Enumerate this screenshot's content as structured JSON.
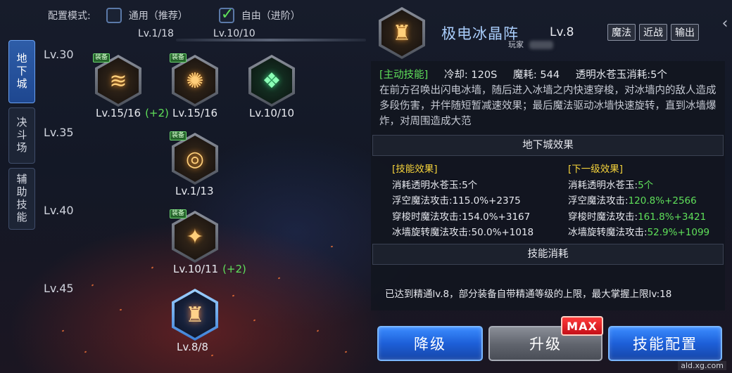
{
  "mode": {
    "label": "配置模式:",
    "options": [
      {
        "label": "通用（推荐）",
        "checked": false
      },
      {
        "label": "自由（进阶）",
        "checked": true
      }
    ]
  },
  "sp": {
    "left": "Lv.1/18",
    "right": "Lv.10/10"
  },
  "side_tabs": [
    {
      "label": "地下城",
      "active": true
    },
    {
      "label": "决斗场",
      "active": false
    },
    {
      "label": "辅助技能",
      "active": false
    }
  ],
  "level_rows": [
    "Lv.30",
    "Lv.35",
    "Lv.40",
    "Lv.45"
  ],
  "skills": [
    {
      "icon": "fire-slash-icon",
      "equip": "装备",
      "level": "Lv.15/16",
      "bonus": "(+2)"
    },
    {
      "icon": "fire-burst-icon",
      "equip": "装备",
      "level": "Lv.15/16",
      "bonus": ""
    },
    {
      "icon": "green-rune-icon",
      "equip": "",
      "level": "Lv.10/10",
      "bonus": ""
    },
    {
      "icon": "fire-orb-icon",
      "equip": "装备",
      "level": "Lv.1/13",
      "bonus": ""
    },
    {
      "icon": "rock-flame-icon",
      "equip": "装备",
      "level": "Lv.10/11",
      "bonus": "(+2)"
    },
    {
      "icon": "crystal-array-icon",
      "equip": "",
      "level": "Lv.8/8",
      "bonus": ""
    }
  ],
  "detail": {
    "title": "极电冰晶阵",
    "level": "Lv.8",
    "owner": "玩家",
    "tags": [
      "魔法",
      "近战",
      "输出"
    ],
    "active_tag": "[主动技能]",
    "cooldown": "冷却: 120S",
    "mana": "魔耗: 544",
    "cost": "透明水苍玉消耗:5个",
    "description": "在前方召唤出闪电冰墙，随后进入冰墙之内快速穿梭，对冰墙内的敌人造成多段伤害，并伴随短暂减速效果；最后魔法驱动冰墙快速旋转，直到冰墙爆炸，对周围造成大范",
    "dungeon_effect_title": "地下城效果",
    "current_head": "[技能效果]",
    "next_head": "[下一级效果]",
    "current": [
      {
        "label": "消耗透明水苍玉:",
        "value": "5个"
      },
      {
        "label": "浮空魔法攻击:",
        "value": "115.0%+2375"
      },
      {
        "label": "穿梭时魔法攻击:",
        "value": "154.0%+3167"
      },
      {
        "label": "冰墙旋转魔法攻击:",
        "value": "50.0%+1018"
      }
    ],
    "next": [
      {
        "label": "消耗透明水苍玉:",
        "value": "5个"
      },
      {
        "label": "浮空魔法攻击:",
        "value": "120.8%+2566"
      },
      {
        "label": "穿梭时魔法攻击:",
        "value": "161.8%+3421"
      },
      {
        "label": "冰墙旋转魔法攻击:",
        "value": "52.9%+1099"
      }
    ],
    "consume_title": "技能消耗",
    "mastery_note": "已达到精通lv.8，部分装备自带精通等级的上限，最大掌握上限lv:18"
  },
  "buttons": {
    "downgrade": "降级",
    "upgrade": "升级",
    "max_badge": "MAX",
    "config": "技能配置"
  },
  "watermark": "ald.xg.com",
  "colors": {
    "accent_blue": "#1d5fd8",
    "highlight_green": "#5fe05a",
    "header_yellow": "#f5d33b",
    "title_blue": "#a9cdfb"
  }
}
